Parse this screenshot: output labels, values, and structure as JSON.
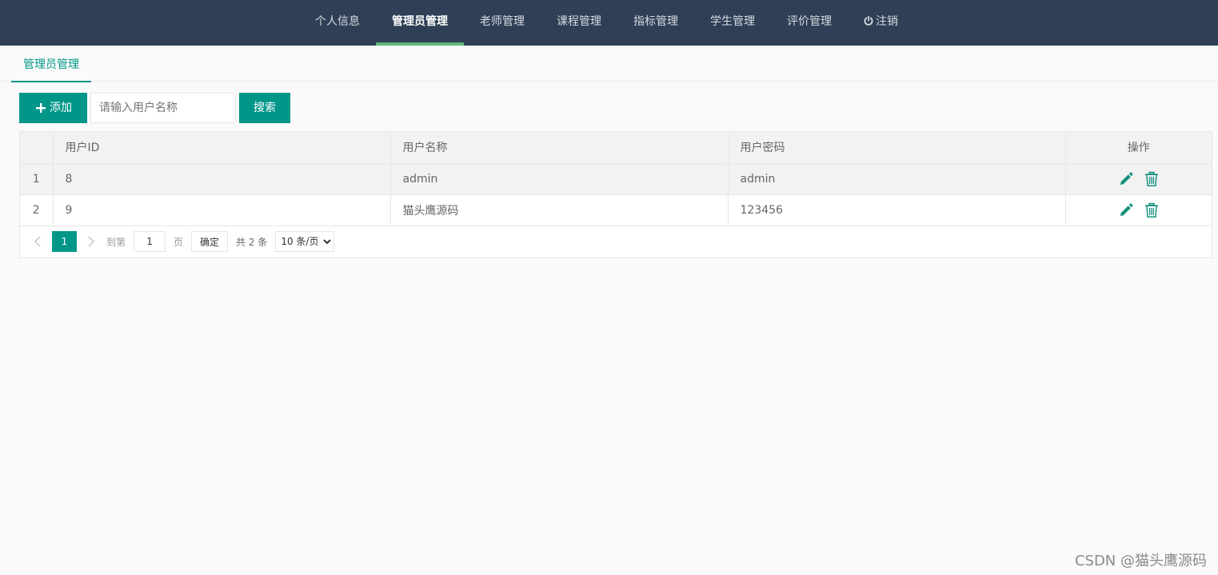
{
  "nav": {
    "items": [
      {
        "label": "个人信息"
      },
      {
        "label": "管理员管理"
      },
      {
        "label": "老师管理"
      },
      {
        "label": "课程管理"
      },
      {
        "label": "指标管理"
      },
      {
        "label": "学生管理"
      },
      {
        "label": "评价管理"
      },
      {
        "label": "注销"
      }
    ],
    "active_index": 1,
    "logout_icon": "power-icon"
  },
  "tabs": {
    "active_label": "管理员管理"
  },
  "toolbar": {
    "add_label": "添加",
    "search_placeholder": "请输入用户名称",
    "search_value": "",
    "search_label": "搜索"
  },
  "table": {
    "columns": [
      "",
      "用户ID",
      "用户名称",
      "用户密码",
      "操作"
    ],
    "rows": [
      {
        "index": "1",
        "id": "8",
        "name": "admin",
        "password": "admin"
      },
      {
        "index": "2",
        "id": "9",
        "name": "猫头鹰源码",
        "password": "123456"
      }
    ],
    "row_actions": [
      "edit-icon",
      "trash-icon"
    ]
  },
  "pager": {
    "current_page": "1",
    "goto_label": "到第",
    "goto_value": "1",
    "page_label": "页",
    "confirm_label": "确定",
    "total_label": "共 2 条",
    "page_size_option": "10 条/页"
  },
  "colors": {
    "nav_bg": "#2f3f55",
    "accent": "#009688",
    "active_underline": "#5fb878"
  },
  "watermark": "CSDN @猫头鹰源码"
}
